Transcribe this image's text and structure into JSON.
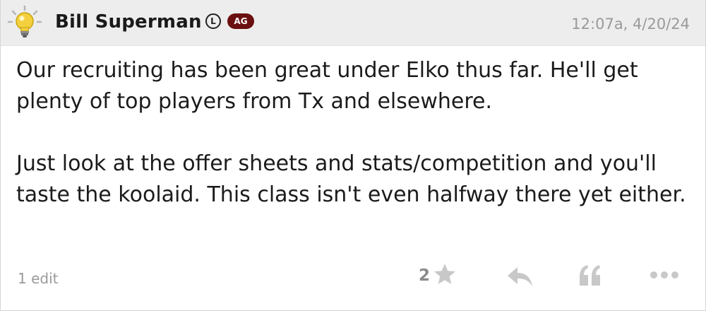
{
  "post": {
    "author": "Bill Superman",
    "badges": {
      "l": "L",
      "ag": "AG"
    },
    "timestamp": "12:07a, 4/20/24",
    "paragraphs": [
      "Our recruiting has been great under Elko thus far. He'll get plenty of top players from Tx and elsewhere.",
      "Just look at the offer sheets and stats/competition and you'll taste the koolaid. This class isn't even halfway there yet either."
    ],
    "edit_count": "1 edit",
    "like_count": "2"
  },
  "icons": {
    "avatar": "lightbulb-icon",
    "like": "star-icon",
    "reply": "reply-icon",
    "quote": "quote-icon",
    "more": "more-icon"
  },
  "colors": {
    "header_bg": "#ededed",
    "badge_ag_bg": "#6b1010",
    "muted_text": "#9a9a9a",
    "icon_gray": "#c8c8c8"
  }
}
